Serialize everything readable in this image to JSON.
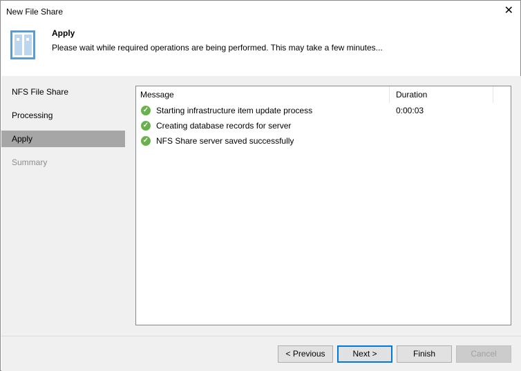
{
  "window": {
    "title": "New File Share",
    "close": "✕"
  },
  "header": {
    "title": "Apply",
    "subtitle": "Please wait while required operations are being performed. This may take a few minutes..."
  },
  "steps": [
    {
      "label": "NFS File Share"
    },
    {
      "label": "Processing"
    },
    {
      "label": "Apply"
    },
    {
      "label": "Summary"
    }
  ],
  "log": {
    "columns": [
      "Message",
      "Duration"
    ],
    "rows": [
      {
        "message": "Starting infrastructure item update process",
        "duration": "0:00:03",
        "status": "success"
      },
      {
        "message": "Creating database records for server",
        "duration": "",
        "status": "success"
      },
      {
        "message": "NFS Share server saved successfully",
        "duration": "",
        "status": "success"
      }
    ]
  },
  "buttons": {
    "previous": "< Previous",
    "next": "Next >",
    "finish": "Finish",
    "cancel": "Cancel"
  }
}
